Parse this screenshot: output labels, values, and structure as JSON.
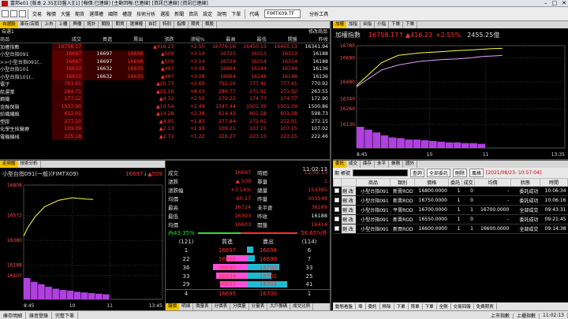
{
  "window": {
    "title": "富邦e01 [版本 2.35][日盤入][1] [報價:已連線] [主動回報:已連線] [資訊已連線] [資訊已連線]",
    "min": "–",
    "max": "□",
    "close": "✕"
  },
  "menu": {
    "items": [
      "交易",
      "報價",
      "大盤",
      "期貨",
      "選擇權",
      "國際",
      "權證",
      "技術分析",
      "選股",
      "新聞",
      "資訊",
      "設定",
      "說明",
      "下單"
    ],
    "code_label": "代碼",
    "code_value": "FIMTX09.TF",
    "page_label": "分析工具"
  },
  "colors": {
    "up": "#ff3030",
    "down": "#2ee02e",
    "accent": "#f2c200",
    "buy": "#ff4fd8",
    "sell": "#22b8d0"
  },
  "quote_panel": {
    "tabs": [
      "自選股",
      "庫存/店頭",
      "上市",
      "上櫃",
      "興櫃",
      "統計",
      "類股",
      "期貨",
      "選擇權",
      "自訂",
      "特別",
      "指標",
      "期貨",
      "類股"
    ],
    "right_label": "修改商品",
    "group_label": "自選1",
    "columns": [
      "商品",
      "成交",
      "買進",
      "賣出",
      "漲跌",
      "漲幅%",
      "最高",
      "最低",
      "開盤",
      "昨收"
    ],
    "rows": [
      {
        "name": "加權指數",
        "price": "16758.17",
        "bid": "",
        "ask": "",
        "chg": "▲416.23",
        "pct": "+2.55",
        "high": "16776.16",
        "low": "16450.13",
        "open": "16450.13",
        "prev": "16341.94",
        "dir": "up"
      },
      {
        "name": "小型台指091",
        "price": "16697",
        "bid": "16697",
        "ask": "16698",
        "chg": "▲509",
        "pct": "+3.14",
        "high": "16725",
        "low": "16313",
        "open": "16313",
        "prev": "16188",
        "dir": "up"
      },
      {
        "name": ">>小型台指091(..",
        "price": "16697",
        "bid": "16697",
        "ask": "16698",
        "chg": "▲509",
        "pct": "+3.14",
        "high": "16724",
        "low": "16314",
        "open": "16314",
        "prev": "16188",
        "dir": "up"
      },
      {
        "name": "小型台指101",
        "price": "16633",
        "bid": "16632",
        "ask": "16635",
        "chg": "▲497",
        "pct": "+3.08",
        "high": "16664",
        "low": "16144",
        "open": "16144",
        "prev": "16136",
        "dir": "up"
      },
      {
        "name": "小型台指101(..",
        "price": "16633",
        "bid": "16632",
        "ask": "16635",
        "chg": "▲497",
        "pct": "+3.08",
        "high": "16664",
        "low": "16148",
        "open": "16148",
        "prev": "16136",
        "dir": "up"
      },
      {
        "name": "電子",
        "price": "791.65",
        "bid": "",
        "ask": "",
        "chg": "▲20.73",
        "pct": "+2.69",
        "high": "792.26",
        "low": "777.41",
        "open": "777.41",
        "prev": "770.92",
        "dir": "up"
      },
      {
        "name": "航運業",
        "price": "284.71",
        "bid": "",
        "ask": "",
        "chg": "▲21.16",
        "pct": "+8.03",
        "high": "286.77",
        "low": "271.92",
        "open": "271.92",
        "prev": "263.55",
        "dir": "up"
      },
      {
        "name": "鋼鐵",
        "price": "177.22",
        "bid": "",
        "ask": "",
        "chg": "▲4.32",
        "pct": "+2.50",
        "high": "179.22",
        "low": "174.77",
        "open": "174.77",
        "prev": "172.90",
        "dir": "up"
      },
      {
        "name": "金融保險",
        "price": "1537.90",
        "bid": "",
        "ask": "",
        "chg": "▲10.54",
        "pct": "+2.49",
        "high": "1547.44",
        "low": "1501.39",
        "open": "1501.39",
        "prev": "1500.86",
        "dir": "up"
      },
      {
        "name": "紡織纖維",
        "price": "612.01",
        "bid": "",
        "ask": "",
        "chg": "▲14.28",
        "pct": "+2.38",
        "high": "614.42",
        "low": "601.58",
        "open": "601.58",
        "prev": "598.73",
        "dir": "up"
      },
      {
        "name": "塑膠",
        "price": "277.10",
        "bid": "",
        "ask": "",
        "chg": "▲4.95",
        "pct": "+1.83",
        "high": "277.84",
        "low": "272.91",
        "open": "272.91",
        "prev": "272.15",
        "dir": "up"
      },
      {
        "name": "化學生技醫療",
        "price": "109.09",
        "bid": "",
        "ask": "",
        "chg": "▲2.13",
        "pct": "+1.99",
        "high": "109.21",
        "low": "107.15",
        "open": "107.15",
        "prev": "107.02",
        "dir": "up"
      },
      {
        "name": "電機機械",
        "price": "225.18",
        "bid": "",
        "ask": "",
        "chg": "▲2.72",
        "pct": "+1.22",
        "high": "226.27",
        "low": "223.15",
        "open": "223.15",
        "prev": "222.46",
        "dir": "up"
      }
    ]
  },
  "index_panel": {
    "tabs": [
      "加權",
      "加指",
      "台指",
      "小指",
      "下單",
      "下單"
    ],
    "name": "加權指數",
    "price": "16758.17",
    "arrow": "↑",
    "change": "▲416.23",
    "pct": "+2.55%",
    "volume": "2455.25億",
    "y_ticks": [
      "16780",
      "16680",
      "16480",
      "16340",
      "16260",
      "16130"
    ],
    "x_ticks": [
      "8:45",
      "10",
      "11",
      "13:35"
    ]
  },
  "mtx_panel": {
    "tabs": [
      "走勢圖",
      "技術分析"
    ],
    "title": "小型台指091(一般)(FIMTX09)",
    "price": "16697",
    "arrow": "↓",
    "change": "▲509",
    "time": "11:02:13",
    "y_ticks": [
      "16808",
      "16572",
      "16380",
      "16188",
      "16107"
    ],
    "x_ticks": [
      "8:45",
      "10",
      "11",
      "13:45"
    ],
    "bottom_tabs": [
      "報價",
      "明細",
      "價量表",
      "分價表",
      "分價量",
      "分量表",
      "大戶籌碼",
      "成交比例"
    ]
  },
  "detail": {
    "rows": [
      {
        "k": "成交",
        "v": "16697",
        "k2": "時間",
        "v2": "11:02:13"
      },
      {
        "k": "漲跌",
        "v": "▲ 509",
        "k2": "單量",
        "v2": "1"
      },
      {
        "k": "漲跌幅",
        "v": "+3.14%",
        "k2": "總量",
        "v2": "154385"
      },
      {
        "k": "均價",
        "v": "-60.17",
        "k2": "昨量",
        "v2": "303548"
      },
      {
        "k": "最高",
        "v": "16724",
        "k2": "未平倉",
        "v2": "36189"
      },
      {
        "k": "最低",
        "v": "16393",
        "k2": "昨收",
        "v2": "16188"
      },
      {
        "k": "均價",
        "v": "16603",
        "k2": "開盤",
        "v2": "16414"
      }
    ],
    "inner_pct": "內43.35%",
    "outer_pct": "56.65%外",
    "bid_total": "(121)",
    "ask_total": "(114)",
    "bid_header": "買進",
    "ask_header": "賣出",
    "book": [
      {
        "bq": "1",
        "bp": "16697",
        "ap": "16698",
        "aq": "6"
      },
      {
        "bq": "22",
        "bp": "16696",
        "ap": "16699",
        "aq": "7"
      },
      {
        "bq": "36",
        "bp": "16695",
        "ap": "16700",
        "aq": "33"
      },
      {
        "bq": "33",
        "bp": "16694",
        "ap": "16701",
        "aq": "25"
      },
      {
        "bq": "29",
        "bp": "16693",
        "ap": "16702",
        "aq": "41"
      }
    ],
    "last_bq": "4",
    "last_bp": "16695",
    "last_ap": "16700",
    "last_aq": "1"
  },
  "orders": {
    "tabs": [
      "委託",
      "成交",
      "庫存",
      "未平",
      "帳務",
      "國外"
    ],
    "account_label": "期 帳號",
    "query_label": "查詢",
    "all_label": "全部委託",
    "delete_label": "刪除",
    "batch_label": "風格",
    "timestamp": "[2021/08/23- 10:57:04]",
    "columns": [
      "",
      "",
      "商品",
      "類別",
      "價格",
      "委託",
      "成交",
      "均價",
      "狀態",
      "時間"
    ],
    "rows": [
      {
        "act": "刪 改",
        "product": "小型台指091",
        "type": "新賣ROD",
        "price": "16800.0000",
        "qty": "1",
        "filled": "0",
        "avg": "-",
        "status": "委託成功",
        "time": "10:06:34",
        "tc": "grn"
      },
      {
        "act": "刪 改",
        "product": "小型台指091",
        "type": "新賣ROD",
        "price": "16750.0000",
        "qty": "1",
        "filled": "0",
        "avg": "-",
        "status": "委託成功",
        "time": "10:06:16",
        "tc": "grn"
      },
      {
        "act": "刪 改",
        "product": "小型台指091",
        "type": "平賣ROD",
        "price": "16700.0000",
        "qty": "1",
        "filled": "1",
        "avg": "16700.0000",
        "status": "全部成交",
        "time": "09:43:31",
        "tc": "grn"
      },
      {
        "act": "刪 改",
        "product": "小型台指091",
        "type": "新賣ROD",
        "price": "16550.0000",
        "qty": "1",
        "filled": "0",
        "avg": "-",
        "status": "委託成功",
        "time": "09:21:45",
        "tc": "grn"
      },
      {
        "act": "刪 改",
        "product": "小型台指091",
        "type": "新買ROD",
        "price": "16600.0000",
        "qty": "1",
        "filled": "1",
        "avg": "16600.0000",
        "status": "全部成交",
        "time": "09:14:38",
        "tc": "red"
      }
    ],
    "footer": [
      "動態看盤",
      "埠",
      "委託",
      "移除",
      "下單",
      "買單",
      "下單",
      "全刪",
      "交易回報",
      "免費期貨"
    ]
  },
  "status": {
    "items": [
      "庫存明細",
      "錄音登錄",
      "完整下單"
    ],
    "right": [
      "上市指數",
      "上櫃指數"
    ],
    "clock": "11:02:13"
  },
  "chart_data": [
    {
      "type": "line",
      "title": "加權指數",
      "x_ticks": [
        "8:45",
        "10",
        "11",
        "13:35"
      ],
      "ylim": [
        16130,
        16780
      ],
      "series": [
        {
          "name": "加權指數",
          "color": "#ffff40",
          "x": [
            0,
            0.05,
            0.12,
            0.2,
            0.3,
            0.4,
            0.48,
            0.55,
            0.6,
            0.65,
            0.7
          ],
          "values": [
            16450,
            16530,
            16640,
            16700,
            16720,
            16730,
            16740,
            16745,
            16750,
            16755,
            16758
          ]
        },
        {
          "name": "不含金融",
          "color": "#e0a0ff",
          "x": [
            0,
            0.05,
            0.12,
            0.2,
            0.3,
            0.4,
            0.48,
            0.55,
            0.6,
            0.65,
            0.7
          ],
          "values": [
            16440,
            16500,
            16580,
            16620,
            16650,
            16665,
            16670,
            16680,
            16690,
            16695,
            16700
          ]
        }
      ],
      "volume": [
        30,
        26,
        22,
        18,
        15,
        14,
        12,
        12,
        11,
        10,
        9,
        8,
        8,
        7,
        7,
        6
      ]
    },
    {
      "type": "line",
      "title": "小型台指091(一般)(FIMTX09)",
      "x_ticks": [
        "8:45",
        "10",
        "11",
        "13:45"
      ],
      "ylim": [
        16107,
        16808
      ],
      "series": [
        {
          "name": "成交",
          "color": "#ffff40",
          "x": [
            0,
            0.03,
            0.08,
            0.15,
            0.25,
            0.35,
            0.45,
            0.5
          ],
          "values": [
            16414,
            16480,
            16560,
            16640,
            16690,
            16710,
            16700,
            16697
          ]
        }
      ],
      "volume": [
        34,
        28,
        24,
        20,
        17,
        15,
        14,
        12,
        11,
        10,
        9,
        8
      ]
    }
  ]
}
